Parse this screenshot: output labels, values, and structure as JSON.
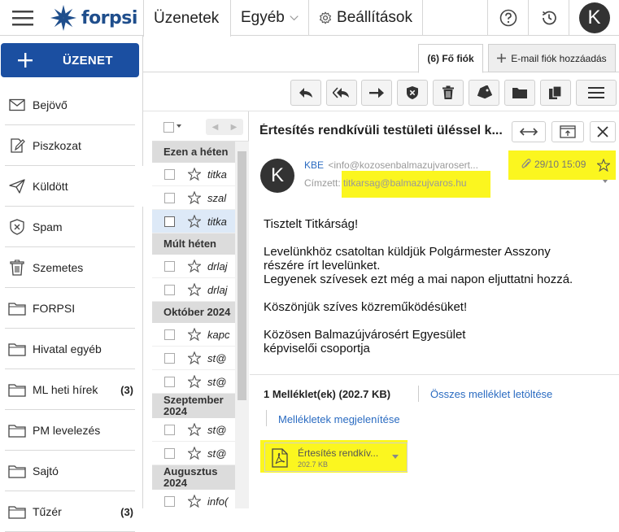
{
  "app": {
    "logo_text": "forpsi",
    "avatar_letter": "K"
  },
  "top_tabs": {
    "messages": "Üzenetek",
    "other": "Egyéb",
    "settings": "Beállítások"
  },
  "sidebar": {
    "compose_label": "ÜZENET",
    "folders": [
      {
        "name": "Bejövő",
        "icon": "envelope-icon"
      },
      {
        "name": "Piszkozat",
        "icon": "draft-icon"
      },
      {
        "name": "Küldött",
        "icon": "paper-plane-icon"
      },
      {
        "name": "Spam",
        "icon": "shield-icon"
      },
      {
        "name": "Szemetes",
        "icon": "trash-icon"
      },
      {
        "name": "FORPSI",
        "icon": "folder-icon"
      },
      {
        "name": "Hivatal egyéb",
        "icon": "folder-icon"
      },
      {
        "name": "ML heti hírek",
        "icon": "folder-icon",
        "count": "(3)"
      },
      {
        "name": "PM levelezés",
        "icon": "folder-icon"
      },
      {
        "name": "Sajtó",
        "icon": "folder-icon"
      },
      {
        "name": "Tűzér",
        "icon": "folder-icon",
        "count": "(3)"
      }
    ]
  },
  "account_tabs": {
    "main": "(6) Fő fiók",
    "add": "E-mail fiók hozzáadás"
  },
  "message_list": {
    "groups": [
      {
        "label": "Ezen a héten",
        "rows": [
          "titka",
          "szal",
          "titka"
        ]
      },
      {
        "label": "Múlt héten",
        "rows": [
          "drlaj",
          "drlaj"
        ]
      },
      {
        "label": "Október 2024",
        "rows": [
          "kapc",
          "st@",
          "st@"
        ]
      },
      {
        "label": "Szeptember 2024",
        "rows": [
          "st@",
          "st@"
        ]
      },
      {
        "label": "Augusztus 2024",
        "rows": [
          "info("
        ]
      }
    ]
  },
  "reader": {
    "subject": "Értesítés rendkívüli testületi üléssel k...",
    "sender_avatar": "K",
    "from_name": "KBE",
    "from_addr": "<info@kozosenbalmazujvarosert...",
    "to_label": "Címzett:",
    "to_addr": "titkarsag@balmazujvaros.hu",
    "date": "29/10 15:09",
    "body": [
      "Tisztelt Titkárság!",
      "Levelünkhöz csatoltan küldjük Polgármester Asszony\nrészére írt levelünket.\nLegyenek szívesek ezt még a mai napon eljuttatni hozzá.",
      "Köszönjük szíves közreműködésüket!",
      "Közösen Balmazújvárosért Egyesület\nképviselői csoportja"
    ],
    "attachments": {
      "count_label": "1 Melléklet(ek) (202.7 KB)",
      "download_all": "Összes melléklet letöltése",
      "show": "Mellékletek megjelenítése",
      "file_name": "Értesítés rendkív...",
      "file_size": "202.7 KB"
    }
  },
  "colors": {
    "brand": "#1b4fa1",
    "link": "#2a6bc1",
    "highlight": "#fbf61f"
  }
}
